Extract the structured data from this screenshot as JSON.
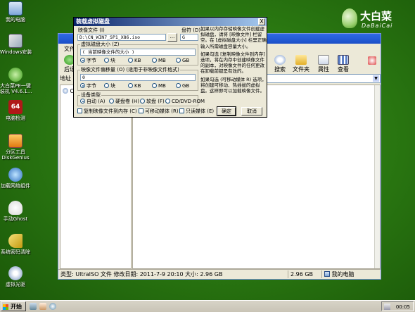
{
  "desktop": {
    "icons": [
      {
        "name": "my-computer",
        "label": "我的电脑"
      },
      {
        "name": "windows-install",
        "label": "Windows安装"
      },
      {
        "name": "dabaicai-pe",
        "label": "大白菜PE一键\n装机 V4.6.1..."
      },
      {
        "name": "computer-check",
        "label": "电脑检测"
      },
      {
        "name": "partition-tool",
        "label": "分区工具\nDiskGenius"
      },
      {
        "name": "network-component",
        "label": "加载网络组件"
      },
      {
        "name": "manual-ghost",
        "label": "手动Ghost"
      },
      {
        "name": "password-clear",
        "label": "系统密码清除"
      },
      {
        "name": "virtual-drive",
        "label": "虚拟光驱"
      }
    ]
  },
  "logo": {
    "cn": "大白菜",
    "en": "DaBaiCai"
  },
  "explorer": {
    "menu": [
      "文件"
    ],
    "toolbar": {
      "back": "后退",
      "search": "搜索",
      "folders": "文件夹",
      "properties": "属性",
      "view": "查看"
    },
    "address_label": "地址",
    "left_item": "CN",
    "status": {
      "type_info": "类型: UltraISO 文件 修改日期: 2011-7-9 20:10 大小: 2.96 GB",
      "size": "2.96 GB",
      "location": "我的电脑"
    }
  },
  "dialog": {
    "title": "装载虚拟磁盘",
    "close": "X",
    "image_file_label": "映像文件 (I)",
    "image_file_value": "D:\\CN_WIN7_SP1_X86.iso",
    "browse": "...",
    "drive_label": "盘符 (D)",
    "drive_value": "G",
    "vdisk_size_group": "虚拟磁盘大小 (Z)",
    "vdisk_size_value": "( 当前映像文件的大小 )",
    "units": [
      "字节",
      "块",
      "KB",
      "MB",
      "GB"
    ],
    "offset_group": "映像文件偏移量 (O) (适用于非映像文件格式)",
    "offset_value": "0",
    "device_type_group": "设备类型",
    "device_types": [
      "自动 (A)",
      "硬盘卷 (H)",
      "软盘 (F)",
      "CD/DVD-ROM"
    ],
    "options": [
      "复制映像文件到内存 (C)",
      "可移动媒体 (R)",
      "只读媒体 (E)"
    ],
    "ok": "确定",
    "cancel": "取消",
    "help": [
      "如果以内存存储映像文件创建虚拟磁盘，请将 [映像文件] 栏留空。在 [虚拟磁盘大小] 栏里正确输入所需磁盘容量大小。",
      "如果勾选 [复制映像文件到内存] 选项，将在内存中创建映像文件的副本，对映像文件的任何更改在卸载前都是有效的。",
      "如果勾选 (可移动媒体 R) 选项，将创建可移动、热插拔的虚拟盘。这样即可以加载映像文件。"
    ]
  },
  "taskbar": {
    "start": "开始",
    "clock": "00:05"
  }
}
